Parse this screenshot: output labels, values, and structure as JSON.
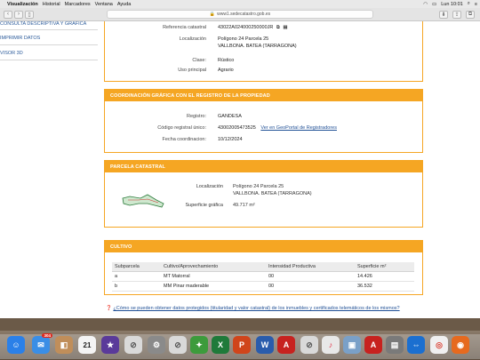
{
  "menubar": {
    "items": [
      "Visualización",
      "Historial",
      "Marcadores",
      "Ventana",
      "Ayuda"
    ],
    "clock": "Lun 10:01"
  },
  "browser": {
    "url": "www1.sedecatastro.gob.es"
  },
  "sidebar": {
    "items": [
      "CONSULTA DESCRIPTIVA Y GRÁFICA",
      "IMPRIMIR DATOS",
      "VISOR 3D"
    ]
  },
  "property": {
    "ref_label": "Referencia catastral",
    "ref_value": "43022A024000250000JR",
    "loc_label": "Localización",
    "loc_line1": "Polígono 24 Parcela 25",
    "loc_line2": "VALLBONA. BATEA (TARRAGONA)",
    "class_label": "Clase:",
    "class_value": "Rústico",
    "use_label": "Uso principal",
    "use_value": "Agrario"
  },
  "registry": {
    "title": "COORDINACIÓN GRÁFICA CON EL REGISTRO DE LA PROPIEDAD",
    "registro_label": "Registro:",
    "registro_value": "GANDESA",
    "cru_label": "Código registral único:",
    "cru_value": "43002005473525",
    "cru_link": "Ver en GeoPortal de Registradores",
    "fecha_label": "Fecha coordinacion:",
    "fecha_value": "10/12/2024"
  },
  "parcel": {
    "title": "PARCELA CATASTRAL",
    "loc_label": "Localización",
    "loc_line1": "Polígono 24 Parcela 25",
    "loc_line2": "VALLBONA. BATEA (TARRAGONA)",
    "area_label": "Superficie gráfica",
    "area_value": "49.717 m²"
  },
  "cultivo": {
    "title": "CULTIVO",
    "headers": [
      "Subparcela",
      "Cultivo/Aprovechamiento",
      "Intensidad Productiva",
      "Superficie m²"
    ],
    "rows": [
      [
        "a",
        "MT Matorral",
        "00",
        "14.426"
      ],
      [
        "b",
        "MM Pinar maderable",
        "00",
        "36.532"
      ]
    ]
  },
  "help_link": "¿Cómo se pueden obtener datos protegidos (titularidad y valor catastral) de los inmuebles y certificados telemáticos de los mismos?",
  "dock": {
    "mail_badge": "304",
    "calendar_day": "21"
  },
  "colors": {
    "accent": "#f5a623",
    "link": "#1f4f95"
  }
}
